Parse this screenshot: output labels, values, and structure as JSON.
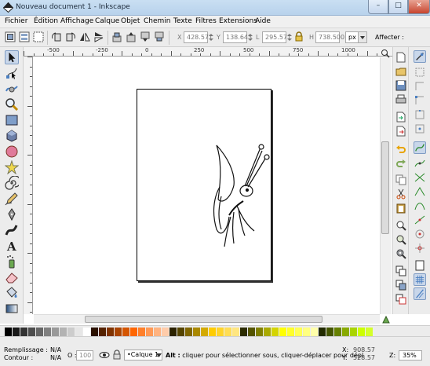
{
  "window": {
    "title": "Nouveau document 1 - Inkscape",
    "minimize": "–",
    "maximize": "□",
    "close": "✕"
  },
  "menu": [
    "Fichier",
    "Édition",
    "Affichage",
    "Calque",
    "Objet",
    "Chemin",
    "Texte",
    "Filtres",
    "Extensions",
    "Aide"
  ],
  "coords": {
    "x_label": "X",
    "x_value": "428.571",
    "y_label": "Y",
    "y_value": "138.643",
    "w_label": "L",
    "w_value": "295.571",
    "h_label": "H",
    "h_value": "738.500",
    "unit": "px",
    "affect_label": "Affecter :"
  },
  "ruler": {
    "h_labels": [
      "-500",
      "-250",
      "0",
      "250",
      "500",
      "750",
      "1000"
    ]
  },
  "status": {
    "fill_label": "Remplissage :",
    "fill_value": "N/A",
    "stroke_label": "Contour :",
    "stroke_value": "N/A",
    "opacity_label": "O :",
    "opacity_value": "100",
    "layer": "•Calque 1",
    "message_bold": "Alt :",
    "message": " cliquer pour sélectionner sous, cliquer-déplacer pour dépl",
    "x_label": "X:",
    "x_value": "908.57",
    "y_label": "Y:",
    "y_value": "528.57",
    "zoom_label": "Z:",
    "zoom_value": "35%"
  },
  "palette_colors": [
    "#000000",
    "#1a1a1a",
    "#333333",
    "#4d4d4d",
    "#666666",
    "#808080",
    "#999999",
    "#b3b3b3",
    "#cccccc",
    "#e6e6e6",
    "#ffffff",
    "#2b1100",
    "#552200",
    "#803300",
    "#aa4400",
    "#d45500",
    "#ff6600",
    "#ff7f2a",
    "#ff9955",
    "#ffb380",
    "#ffccaa",
    "#2b2200",
    "#554400",
    "#806600",
    "#aa8800",
    "#d4aa00",
    "#ffcc00",
    "#ffd42a",
    "#ffdd55",
    "#ffe680",
    "#2b2b00",
    "#555500",
    "#808000",
    "#aaaa00",
    "#d4d400",
    "#ffff00",
    "#ffff2a",
    "#ffff55",
    "#ffff80",
    "#ffffaa",
    "#222b00",
    "#445500",
    "#668000",
    "#88aa00",
    "#aad400",
    "#ccff00",
    "#d4ff2a"
  ],
  "colors": {
    "accent": "#c9d7ea",
    "chrome": "#ececec",
    "title_bg": "#c9dff2",
    "close_btn": "#c7452f"
  }
}
